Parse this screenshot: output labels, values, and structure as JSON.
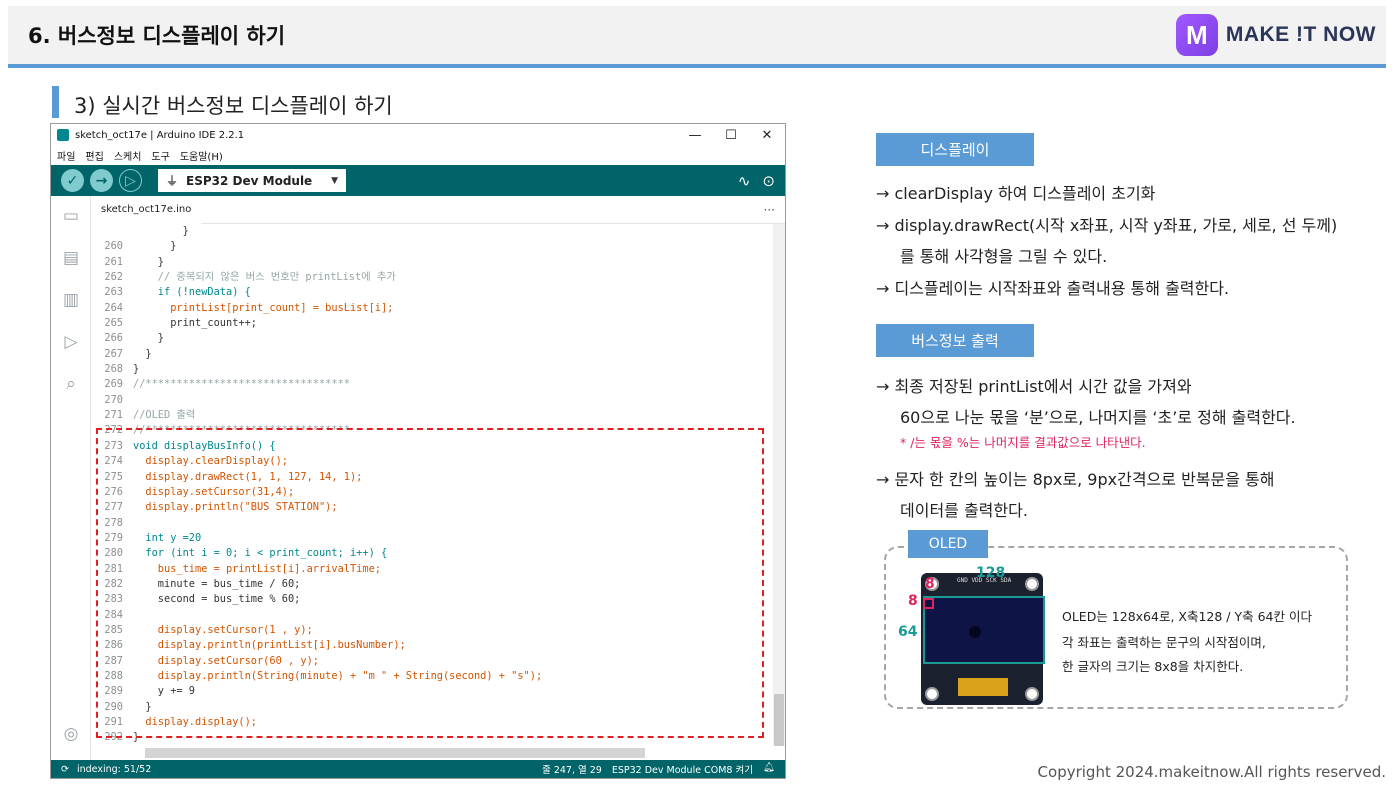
{
  "slide": {
    "title": "6. 버스정보 디스플레이 하기",
    "section_title": "3) 실시간 버스정보 디스플레이 하기",
    "copyright": "Copyright 2024.makeitnow.All rights reserved."
  },
  "logo": {
    "badge": "M",
    "text": "MAKE !T NOW"
  },
  "ide": {
    "window_title": "sketch_oct17e | Arduino IDE 2.2.1",
    "window_controls": [
      "—",
      "☐",
      "✕"
    ],
    "menu": [
      "파일",
      "편집",
      "스케치",
      "도구",
      "도움말(H)"
    ],
    "board": "ESP32 Dev Module",
    "file_tab": "sketch_oct17e.ino",
    "tab_more": "···",
    "status_left": "indexing: 51/52",
    "status_position": "줄 247, 열 29",
    "status_board": "ESP32 Dev Module COM8 켜기",
    "code": [
      {
        "n": "",
        "t": "        }"
      },
      {
        "n": "260",
        "t": "      }"
      },
      {
        "n": "261",
        "t": "    }"
      },
      {
        "n": "262",
        "t": "    // 중복되지 않은 버스 번호만 printList에 추가"
      },
      {
        "n": "263",
        "t": "    if (!newData) {"
      },
      {
        "n": "264",
        "t": "      printList[print_count] = busList[i];"
      },
      {
        "n": "265",
        "t": "      print_count++;"
      },
      {
        "n": "266",
        "t": "    }"
      },
      {
        "n": "267",
        "t": "  }"
      },
      {
        "n": "268",
        "t": "}"
      },
      {
        "n": "269",
        "t": "//*********************************"
      },
      {
        "n": "270",
        "t": ""
      },
      {
        "n": "271",
        "t": "//OLED 출력"
      },
      {
        "n": "272",
        "t": "//*********************************"
      },
      {
        "n": "273",
        "t": "void displayBusInfo() {"
      },
      {
        "n": "274",
        "t": "  display.clearDisplay();"
      },
      {
        "n": "275",
        "t": "  display.drawRect(1, 1, 127, 14, 1);"
      },
      {
        "n": "276",
        "t": "  display.setCursor(31,4);"
      },
      {
        "n": "277",
        "t": "  display.println(\"BUS STATION\");"
      },
      {
        "n": "278",
        "t": ""
      },
      {
        "n": "279",
        "t": "  int y =20"
      },
      {
        "n": "280",
        "t": "  for (int i = 0; i < print_count; i++) {"
      },
      {
        "n": "281",
        "t": "    bus_time = printList[i].arrivalTime;"
      },
      {
        "n": "282",
        "t": "    minute = bus_time / 60;"
      },
      {
        "n": "283",
        "t": "    second = bus_time % 60;"
      },
      {
        "n": "284",
        "t": ""
      },
      {
        "n": "285",
        "t": "    display.setCursor(1 , y);"
      },
      {
        "n": "286",
        "t": "    display.println(printList[i].busNumber);"
      },
      {
        "n": "287",
        "t": "    display.setCursor(60 , y);"
      },
      {
        "n": "288",
        "t": "    display.println(String(minute) + \"m \" + String(second) + \"s\");"
      },
      {
        "n": "289",
        "t": "    y += 9"
      },
      {
        "n": "290",
        "t": "  }"
      },
      {
        "n": "291",
        "t": "  display.display();"
      },
      {
        "n": "292",
        "t": "}"
      },
      {
        "n": "293",
        "t": "//*********************************"
      }
    ]
  },
  "panel": {
    "display_pill": "디스플레이",
    "display_bullets": [
      "→ clearDisplay 하여 디스플레이 초기화",
      "→ display.drawRect(시작 x좌표, 시작 y좌표, 가로, 세로, 선 두께)",
      "를 통해 사각형을 그릴 수 있다.",
      "→ 디스플레이는 시작좌표와 출력내용 통해 출력한다."
    ],
    "bus_pill": "버스정보 출력",
    "bus_bullets": [
      "→ 최종 저장된 printList에서 시간 값을 가져와",
      "60으로 나눈 몫을 ‘분’으로, 나머지를 ‘초’로 정해 출력한다.",
      "→ 문자 한 칸의 높이는 8px로, 9px간격으로 반복문을 통해",
      "데이터를 출력한다."
    ],
    "red_note": "* /는 몫을 %는 나머지를 결과값으로 나타낸다.",
    "oled_pill": "OLED",
    "oled_labels": {
      "width": "128",
      "height": "64",
      "char_w": "8",
      "char_h": "8",
      "pins": "GND VDD SCK SDA"
    },
    "oled_desc": [
      "OLED는 128x64로, X축128 / Y축 64칸 이다",
      "각 좌표는 출력하는 문구의 시작점이며,",
      "한 글자의 크기는 8x8을 차지한다."
    ]
  },
  "colors": {
    "accent": "#5b9bd5",
    "ide_teal": "#006468",
    "highlight_red": "#e02020",
    "oled_teal": "#1a9a93",
    "pink": "#e0245e"
  }
}
